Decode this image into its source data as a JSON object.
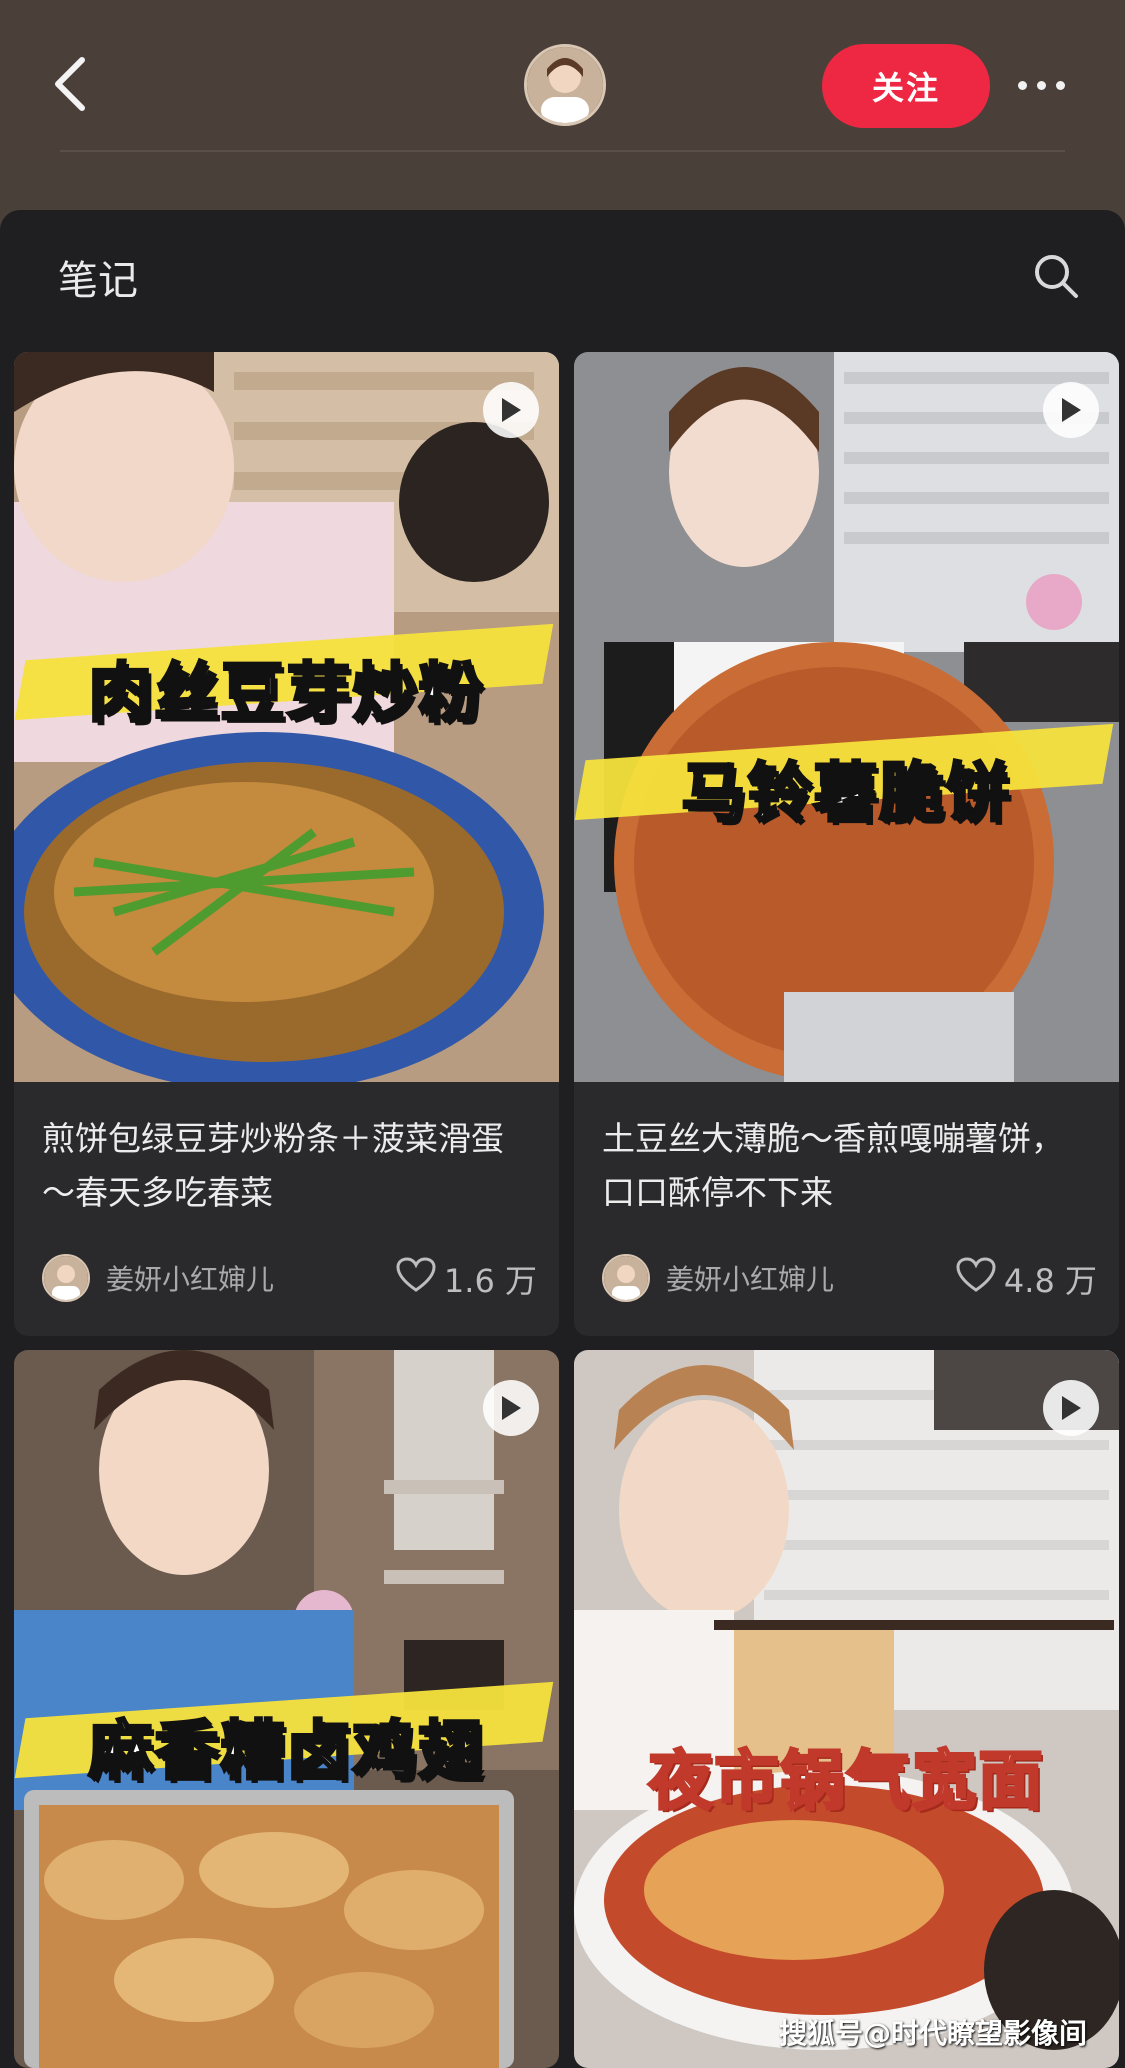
{
  "header": {
    "follow_label": "关注"
  },
  "panel": {
    "title": "笔记"
  },
  "notes": [
    {
      "overlay": "肉丝豆芽炒粉",
      "caption": "煎饼包绿豆芽炒粉条＋菠菜滑蛋～春天多吃春菜",
      "author": "姜妍小红婶儿",
      "likes": "1.6 万"
    },
    {
      "overlay": "马铃薯脆饼",
      "caption": "土豆丝大薄脆～香煎嘎嘣薯饼，口口酥停不下来",
      "author": "姜妍小红婶儿",
      "likes": "4.8 万"
    },
    {
      "overlay": "麻香糟卤鸡翅"
    },
    {
      "overlay": "夜市锅气宽面"
    }
  ],
  "watermark": "搜狐号@时代瞭望影像间",
  "colors": {
    "accent": "#ee2843",
    "panel": "#1f1f21",
    "header": "#4a4039"
  }
}
